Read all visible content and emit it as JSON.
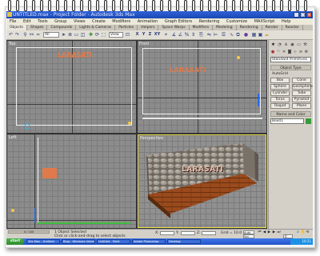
{
  "window": {
    "title": "UNTITLED.max - Project Folder - Autodesk 3ds Max"
  },
  "menubar": {
    "items": [
      "File",
      "Edit",
      "Tools",
      "Group",
      "Views",
      "Create",
      "Modifiers",
      "Animation",
      "Graph Editors",
      "Rendering",
      "Customize",
      "MAXScript",
      "Help"
    ]
  },
  "tabs": [
    "Objects",
    "Shapes",
    "Compounds",
    "Lights & Cameras",
    "Particles",
    "Helpers",
    "Space Warps",
    "Modifiers",
    "Modeling",
    "Rendering",
    "Render",
    "Reactor"
  ],
  "toolbar": {
    "filter_value": "All",
    "view_value": "View",
    "axes": [
      "X",
      "Y",
      "Z",
      "XY"
    ]
  },
  "viewports": {
    "top": {
      "label": "Top",
      "object_text": "LARASATI"
    },
    "front": {
      "label": "Front",
      "object_text": "LARASATI"
    },
    "left": {
      "label": "Left"
    },
    "perspective": {
      "label": "Perspective",
      "object_text": "LARASATI"
    }
  },
  "command_panel": {
    "dropdown_value": "Standard Primitives",
    "object_type_header": "Object Type",
    "autogrid_label": "AutoGrid",
    "buttons": [
      "Box",
      "Cone",
      "Sphere",
      "GeoSphere",
      "Cylinder",
      "Tube",
      "Torus",
      "Pyramid",
      "Teapot",
      "Plane"
    ],
    "name_header": "Name and Color",
    "name_value": "Box01"
  },
  "status": {
    "selection": "1 Object Selected",
    "prompt": "Click or click-and-drag to select objects",
    "time_slider": "0 / 100",
    "x_label": "X:",
    "y_label": "Y:",
    "z_label": "Z:",
    "grid": "Grid = 10.0",
    "autokey_label": "Auto Key",
    "setkey_label": "Set Key",
    "frame": "0"
  },
  "taskbar": {
    "start_label": "start",
    "items": [
      "3ds Max - Untitled",
      "Blog - Windows Intern...",
      "Untitled - Paint",
      "Adobe Photoshop",
      "Desktop"
    ],
    "clock": "10:21"
  },
  "colors": {
    "title_blue": "#1b48b3",
    "viewport_grey": "#8c8c8c",
    "object_orange": "#e07a4a",
    "taskbar_blue": "#2354c9"
  }
}
